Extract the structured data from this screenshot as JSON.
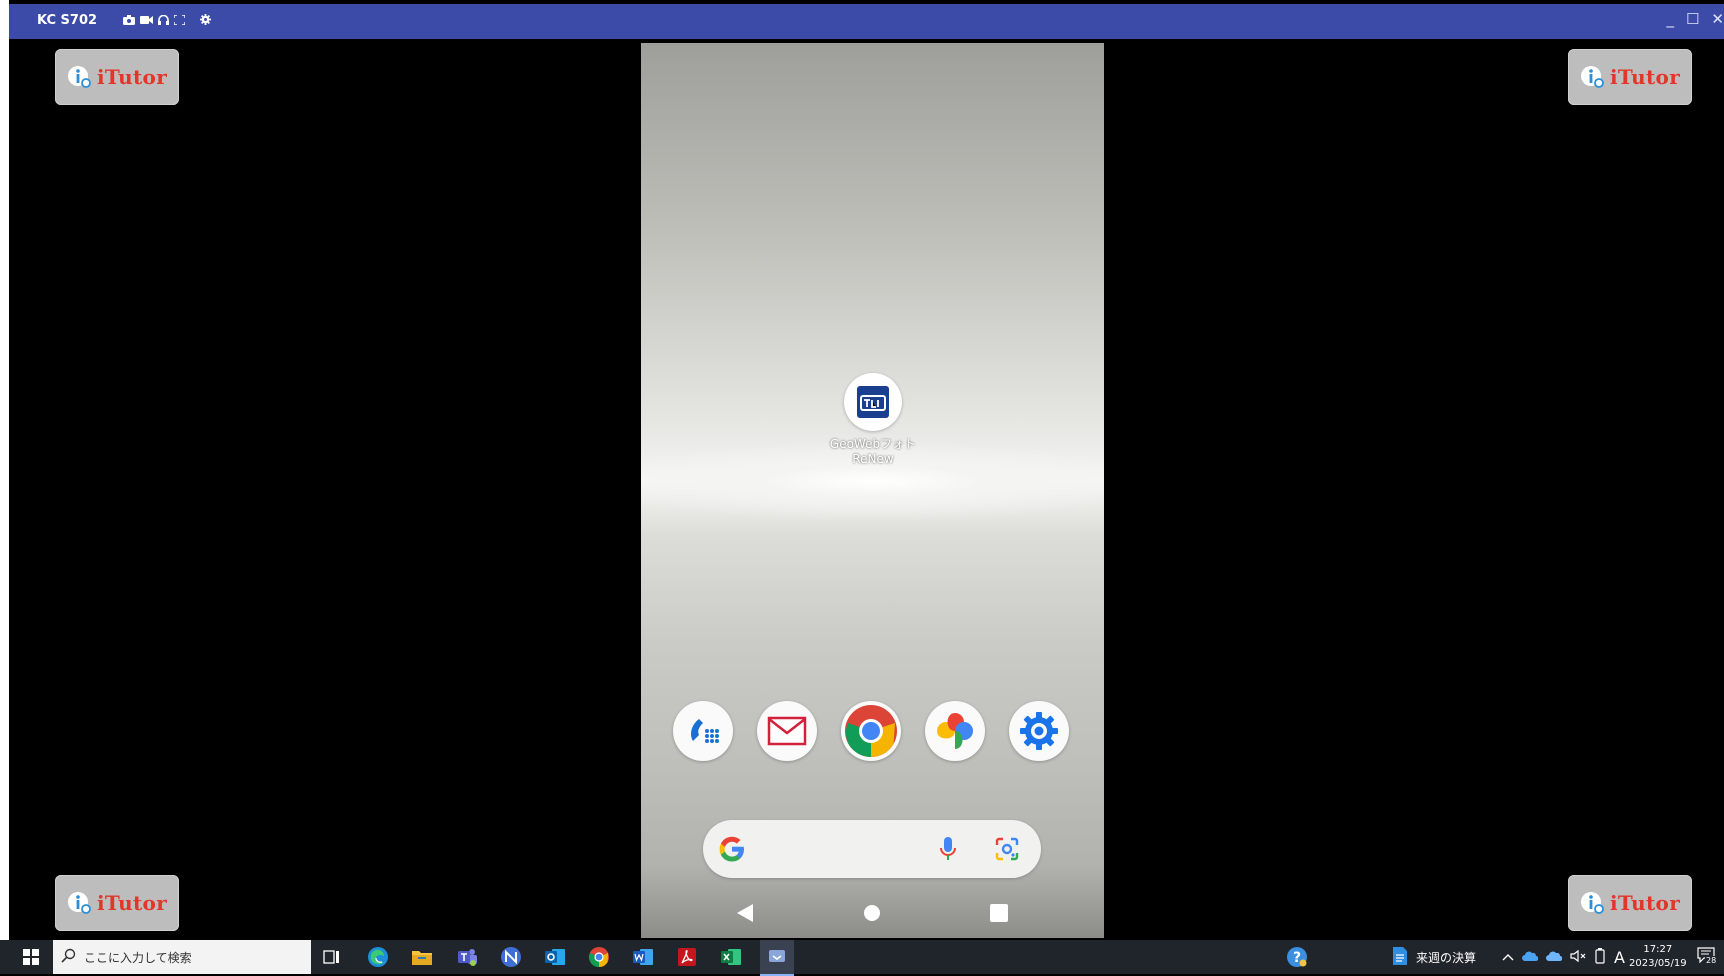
{
  "window": {
    "title": "KC S702",
    "controls": [
      "minimize",
      "maximize",
      "close"
    ]
  },
  "watermark": {
    "text": "iTutor"
  },
  "phone": {
    "home_app": {
      "label_line1": "GeoWebフォト",
      "label_line2": "ReNew"
    },
    "dock": [
      "phone-icon",
      "mail-icon",
      "chrome-icon",
      "photos-icon",
      "settings-icon"
    ]
  },
  "taskbar": {
    "search_placeholder": "ここに入力して検索",
    "tray_label": "来週の決算",
    "time": "17:27",
    "date": "2023/05/19",
    "ime": "A",
    "notifications": "28"
  },
  "colors": {
    "titlebar": "#3c4ba7",
    "taskbar": "#20242b",
    "watermark_text": "#e2362b"
  }
}
